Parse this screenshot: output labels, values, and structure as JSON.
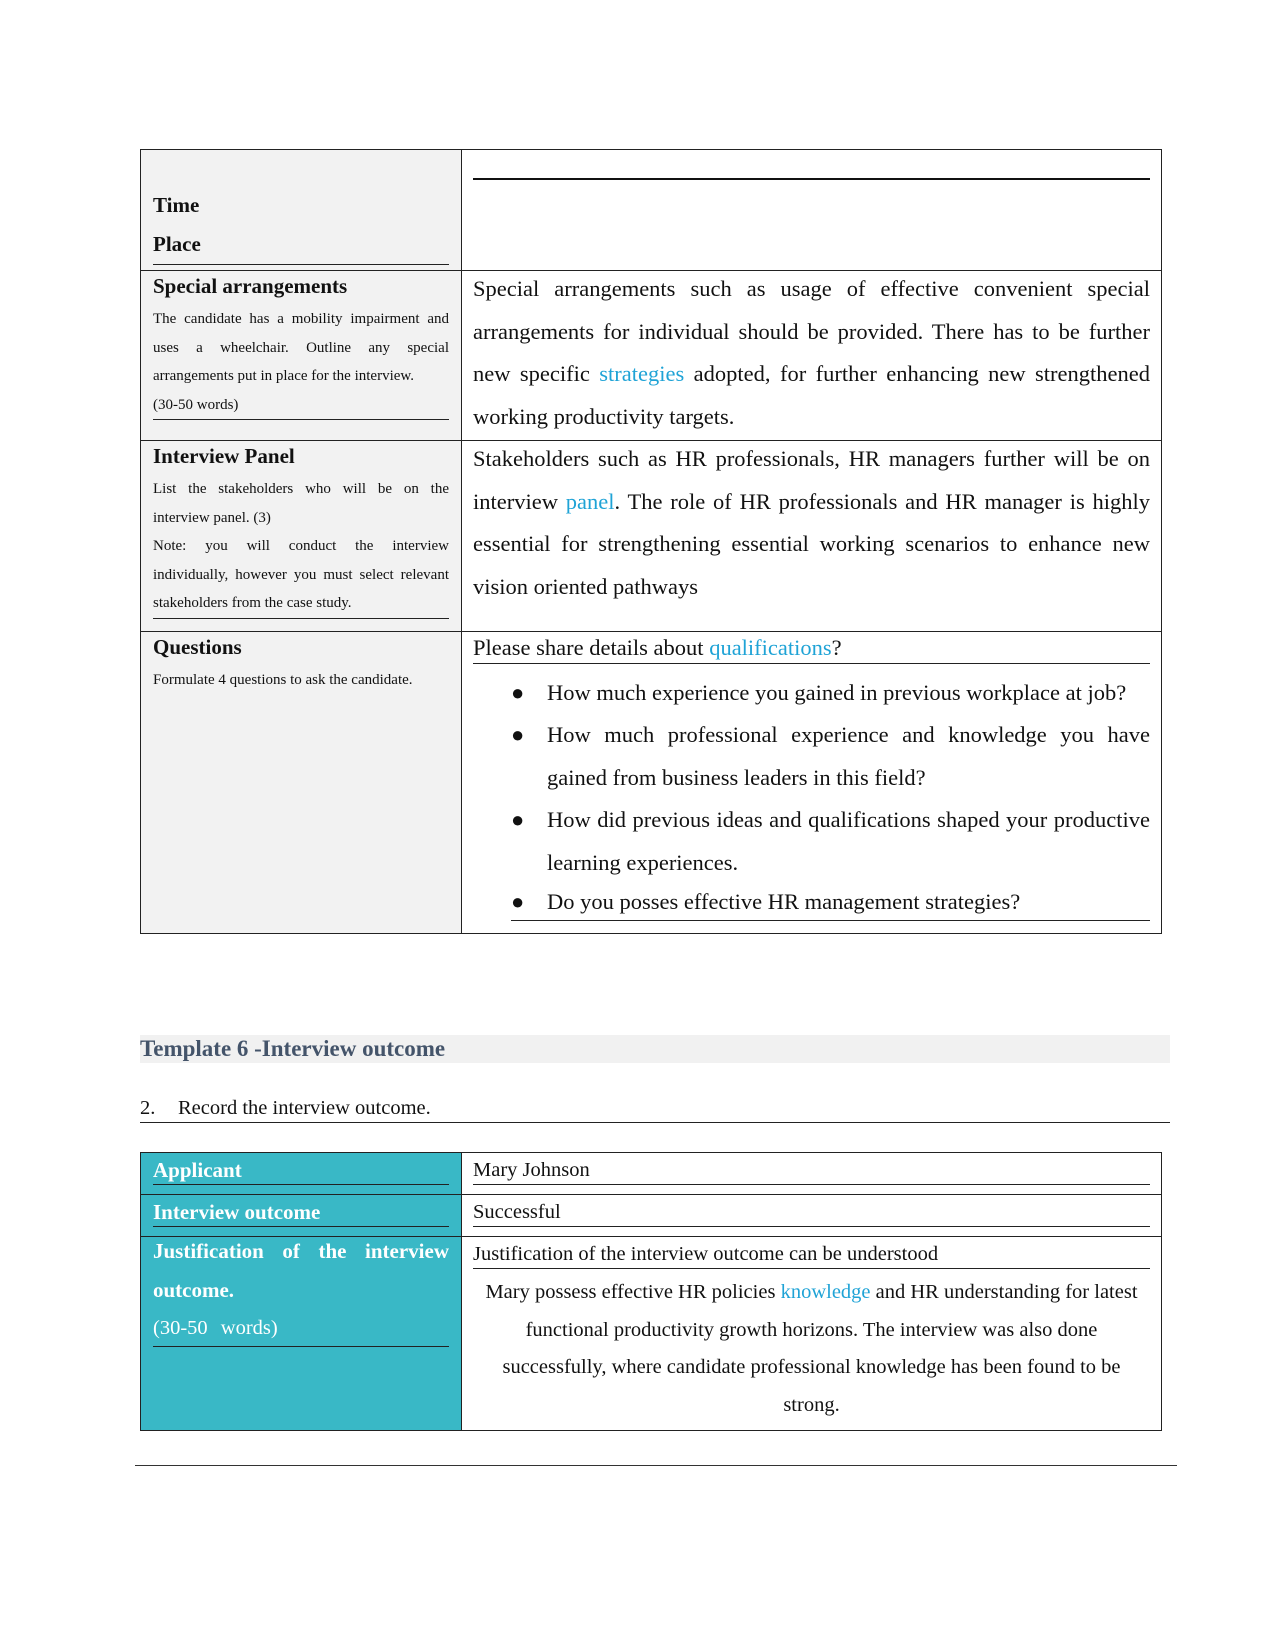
{
  "table1": {
    "time_place": {
      "labels": [
        "Time",
        "Place"
      ],
      "value": ""
    },
    "special_arrangements": {
      "title": "Special arrangements",
      "instructions": "The candidate has a mobility impairment and uses a wheelchair. Outline any special arrangements put in place for the interview.",
      "word_limit": "(30-50 words)",
      "answer_part1": "Special arrangements such as usage of effective convenient special arrangements for individual should be provided. There has to be further new specific ",
      "answer_link": "strategies",
      "answer_part2": " adopted, for further enhancing new strengthened working productivity targets."
    },
    "interview_panel": {
      "title": "Interview Panel",
      "instructions": "List the stakeholders who will be on the interview panel. (3)",
      "note": "Note: you will conduct the interview individually, however you must select relevant stakeholders from the case study.",
      "answer_part1": "Stakeholders such as HR professionals, HR managers further will be on interview ",
      "answer_link": "panel",
      "answer_part2": ". The role of HR professionals and HR manager is highly essential for strengthening essential working scenarios to enhance new vision oriented pathways"
    },
    "questions": {
      "title": "Questions",
      "instructions": "Formulate 4 questions to ask the candidate.",
      "intro_part1": "Please share details about ",
      "intro_link": "qualifications",
      "intro_part2": "?",
      "bullet_icon": "bullet-dot",
      "items": [
        "How much experience you gained in previous workplace at job?",
        "How much professional experience and knowledge you have gained from business leaders in this field?",
        "How did previous ideas and qualifications shaped your productive learning experiences.",
        "Do you posses effective HR management strategies?"
      ]
    }
  },
  "section": {
    "heading": "Template 6 -Interview outcome",
    "instruction_number": "2.",
    "instruction_text": "Record the interview outcome."
  },
  "table2": {
    "applicant_label": "Applicant",
    "applicant_value": "Mary Johnson",
    "outcome_label": "Interview outcome",
    "outcome_value": "Successful",
    "justification_label_line1": "Justification of the interview",
    "justification_label_line2": "outcome.",
    "justification_word_limit": "(30-50 words)",
    "justification_heading": "Justification of the interview outcome can be understood",
    "justification_part1": "Mary possess effective HR policies ",
    "justification_link": "knowledge",
    "justification_part2": " and HR understanding for latest functional productivity growth horizons. The interview was also done successfully, where candidate professional knowledge has been found to be strong."
  },
  "colors": {
    "link": "#1fa3d6",
    "label_cell_bg": "#f2f2f2",
    "outcome_label_bg": "#39b8c6",
    "section_heading": "#44546a"
  }
}
